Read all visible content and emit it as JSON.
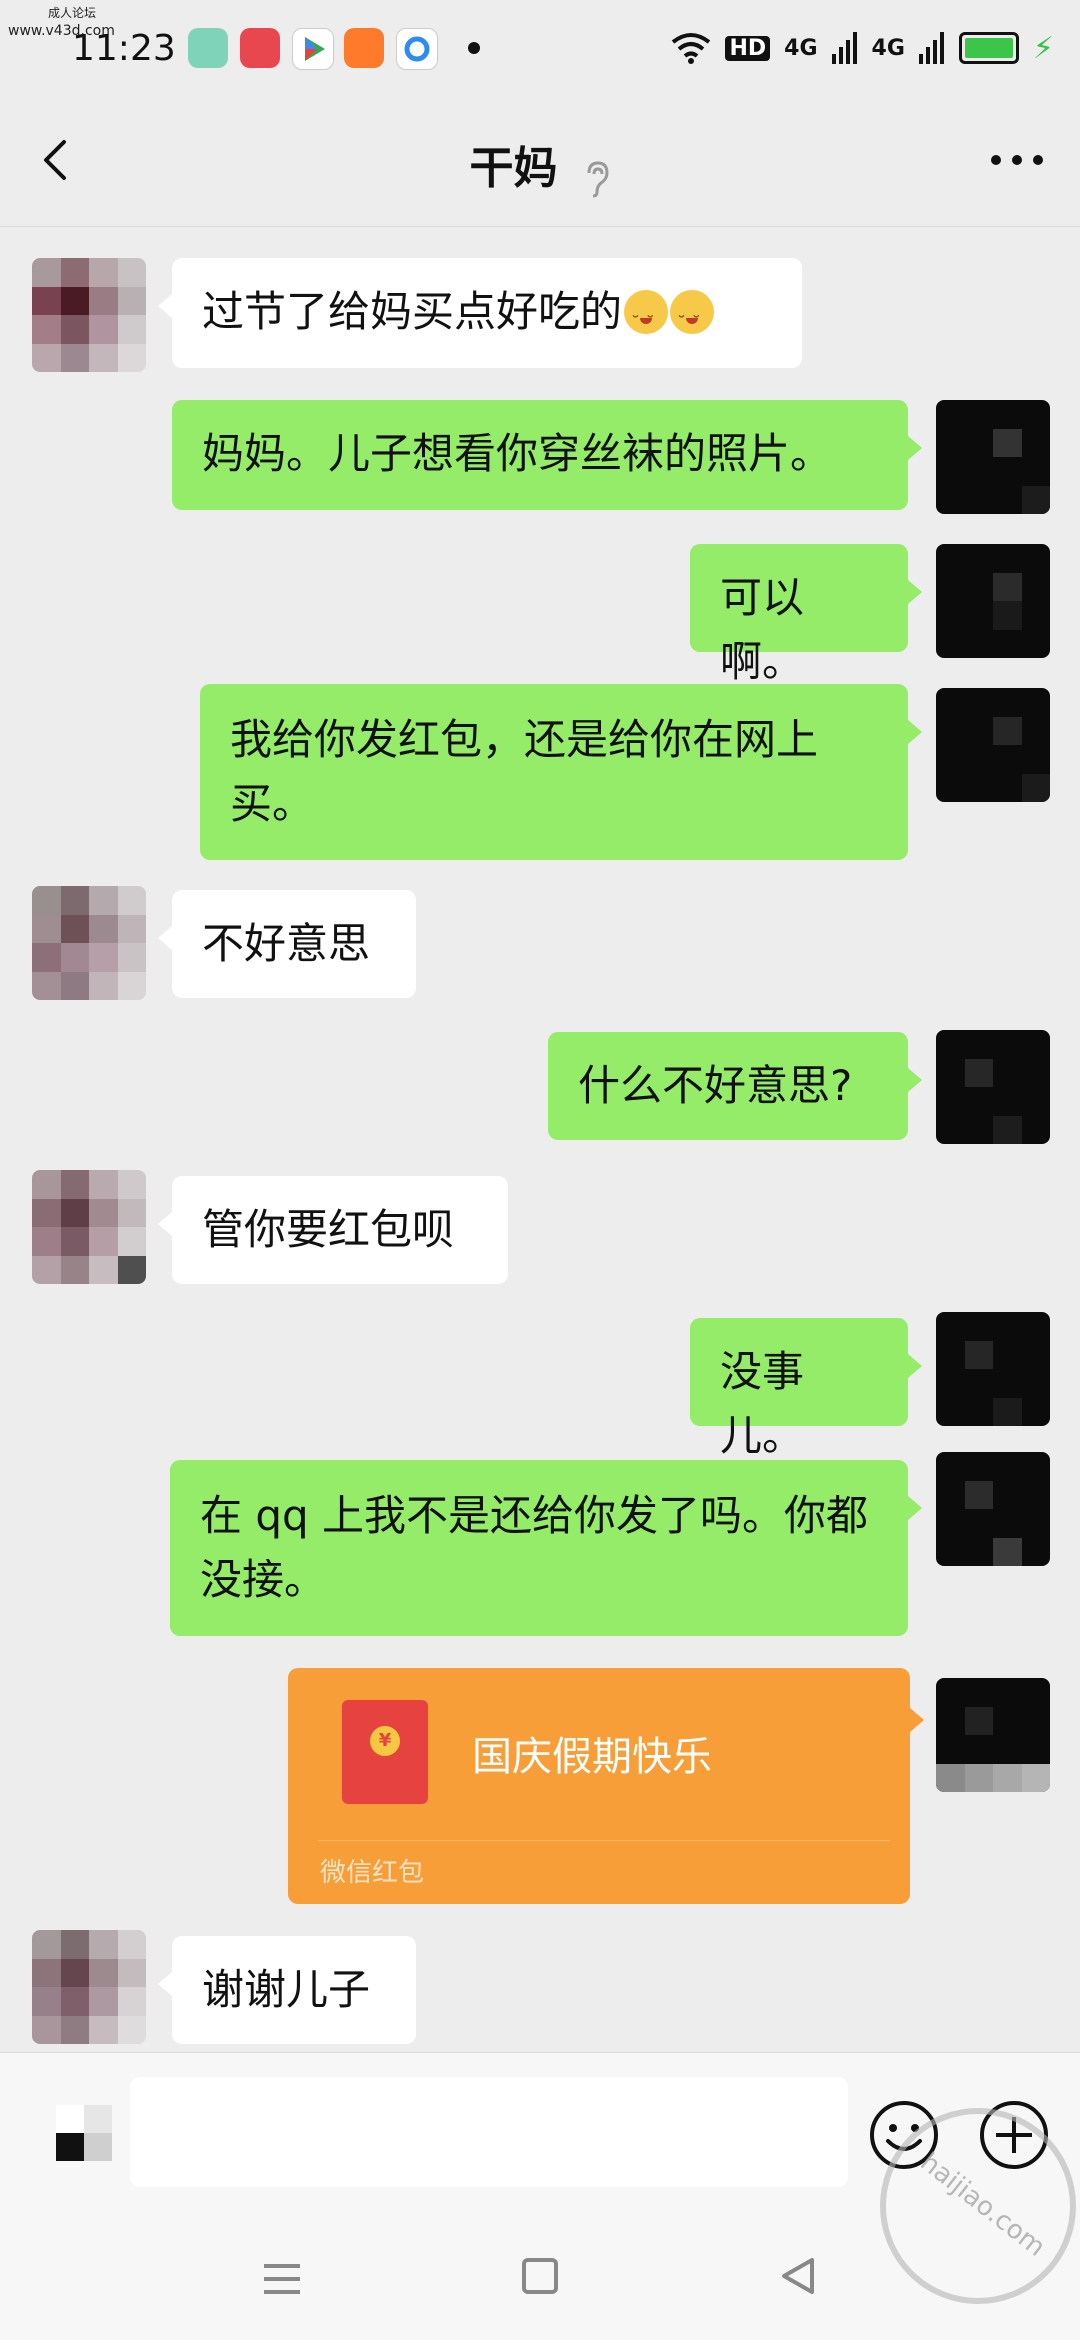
{
  "watermark": {
    "line1": "成人论坛",
    "line2": "www.v43d.com",
    "stamp": "haijiao.com"
  },
  "status_bar": {
    "time": "11:23",
    "network": "HD",
    "signal_1": "4G",
    "signal_2": "4G"
  },
  "header": {
    "title": "干妈"
  },
  "messages": [
    {
      "side": "in",
      "text": "过节了给妈买点好吃的"
    },
    {
      "side": "out",
      "text": "妈妈。儿子想看你穿丝袜的照片。"
    },
    {
      "side": "out",
      "text": "可以啊。"
    },
    {
      "side": "out",
      "text": "我给你发红包，还是给你在网上买。"
    },
    {
      "side": "in",
      "text": "不好意思"
    },
    {
      "side": "out",
      "text": "什么不好意思?"
    },
    {
      "side": "in",
      "text": "管你要红包呗"
    },
    {
      "side": "out",
      "text": "没事儿。"
    },
    {
      "side": "out",
      "text": "在 qq 上我不是还给你发了吗。你都没接。"
    },
    {
      "side": "in",
      "text": "谢谢儿子"
    }
  ],
  "red_packet": {
    "title": "国庆假期快乐",
    "label": "微信红包",
    "coin": "¥"
  },
  "input": {
    "placeholder": ""
  },
  "colors": {
    "out_bubble": "#95ec69",
    "in_bubble": "#ffffff",
    "red_packet": "#f79e39",
    "background": "#ededed"
  }
}
